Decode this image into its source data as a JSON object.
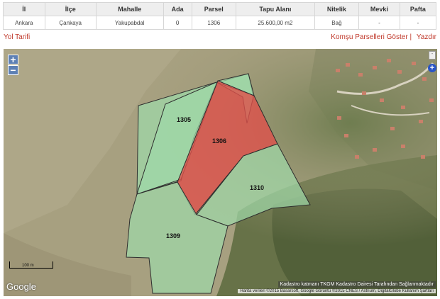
{
  "table": {
    "headers": [
      "İl",
      "İlçe",
      "Mahalle",
      "Ada",
      "Parsel",
      "Tapu Alanı",
      "Nitelik",
      "Mevki",
      "Pafta"
    ],
    "row": [
      "Ankara",
      "Çankaya",
      "Yakupabdal",
      "0",
      "1306",
      "25.600,00 m2",
      "Bağ",
      "-",
      "-"
    ]
  },
  "links": {
    "directions": "Yol Tarifi",
    "neighbors": "Komşu Parselleri Göster |",
    "print": "Yazdır"
  },
  "map": {
    "zoom_in": "+",
    "zoom_out": "−",
    "parcels": [
      "1305",
      "1306",
      "1310",
      "1309"
    ],
    "scale_label": "100 m",
    "logo": "Google",
    "credit_kadastro": "Kadastro katmanı TKGM Kadastro Dairesi Tarafından Sağlanmaktadır",
    "credit_imagery": "Harita verileri ©2015 Basarsoft, Google Görüntü ©2015 CNES / Astrium, DigitalGlobe     Kullanım Şartları",
    "colors": {
      "selected_parcel": "#e0504a",
      "parcel": "#9fd8a8",
      "parcel_outline": "#2e2e2e"
    }
  }
}
